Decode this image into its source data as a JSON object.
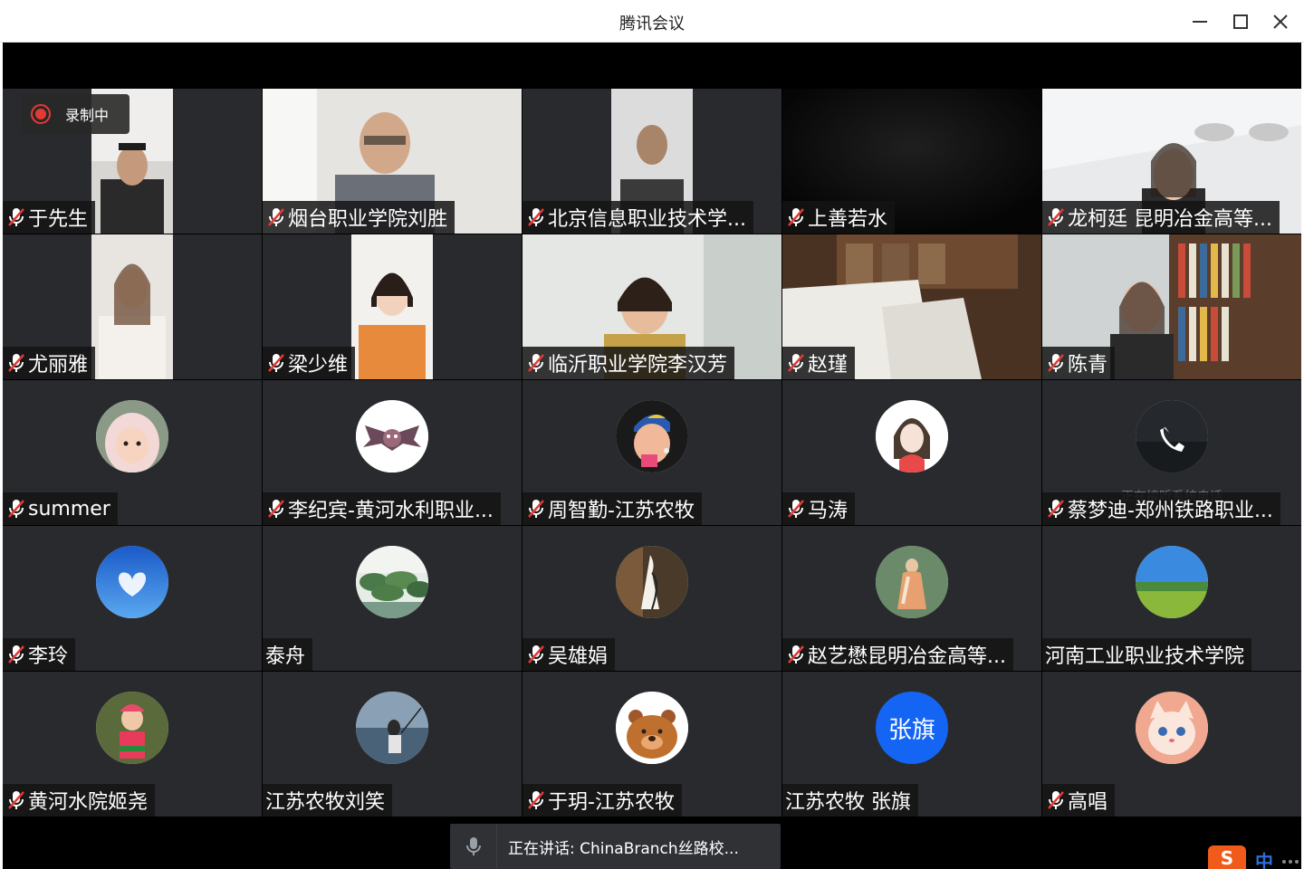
{
  "window": {
    "title": "腾讯会议",
    "controls": [
      "minimize-icon",
      "maximize-icon",
      "close-icon"
    ]
  },
  "recording": {
    "label": "录制中",
    "color": "#e53935"
  },
  "participants": [
    {
      "name": "于先生",
      "muted": true,
      "media": "video"
    },
    {
      "name": "烟台职业学院刘胜",
      "muted": true,
      "media": "video"
    },
    {
      "name": "北京信息职业技术学...",
      "muted": true,
      "media": "video"
    },
    {
      "name": "上善若水",
      "muted": true,
      "media": "video"
    },
    {
      "name": "龙柯廷 昆明冶金高等...",
      "muted": true,
      "media": "video"
    },
    {
      "name": "尤丽雅",
      "muted": true,
      "media": "video"
    },
    {
      "name": "梁少维",
      "muted": true,
      "media": "video"
    },
    {
      "name": "临沂职业学院李汉芳",
      "muted": true,
      "media": "video"
    },
    {
      "name": "赵瑾",
      "muted": true,
      "media": "video"
    },
    {
      "name": "陈青",
      "muted": true,
      "media": "video"
    },
    {
      "name": "summer",
      "muted": true,
      "media": "avatar",
      "avatar_icon": "child-photo-avatar"
    },
    {
      "name": "李纪宾-黄河水利职业...",
      "muted": true,
      "media": "avatar",
      "avatar_icon": "bat-cartoon-avatar"
    },
    {
      "name": "周智勤-江苏农牧",
      "muted": true,
      "media": "avatar",
      "avatar_icon": "pearl-earring-cartoon-avatar"
    },
    {
      "name": "马涛",
      "muted": true,
      "media": "avatar",
      "avatar_icon": "girl-illustration-avatar"
    },
    {
      "name": "蔡梦迪-郑州铁路职业...",
      "muted": true,
      "media": "avatar",
      "avatar_icon": "phone-call-avatar",
      "status": "正在接听系统电话"
    },
    {
      "name": "李玲",
      "muted": true,
      "media": "avatar",
      "avatar_icon": "sky-heart-cloud-avatar"
    },
    {
      "name": "泰舟",
      "muted": false,
      "media": "avatar",
      "avatar_icon": "lotus-pond-avatar"
    },
    {
      "name": "吴雄娟",
      "muted": true,
      "media": "avatar",
      "avatar_icon": "ink-painting-avatar"
    },
    {
      "name": "赵艺懋昆明冶金高等...",
      "muted": true,
      "media": "avatar",
      "avatar_icon": "classical-painting-avatar"
    },
    {
      "name": "河南工业职业技术学院",
      "muted": false,
      "media": "avatar",
      "avatar_icon": "grassland-avatar"
    },
    {
      "name": "黄河水院姬尧",
      "muted": true,
      "media": "avatar",
      "avatar_icon": "girl-photo-avatar"
    },
    {
      "name": "江苏农牧刘笑",
      "muted": false,
      "media": "avatar",
      "avatar_icon": "seaside-fishing-avatar"
    },
    {
      "name": "于玥-江苏农牧",
      "muted": true,
      "media": "avatar",
      "avatar_icon": "bear-cartoon-avatar"
    },
    {
      "name": "江苏农牧 张旗",
      "muted": false,
      "media": "avatar",
      "avatar_text": "张旗",
      "avatar_color": "#1565f5"
    },
    {
      "name": "高唱",
      "muted": true,
      "media": "avatar",
      "avatar_icon": "cat-cartoon-avatar"
    }
  ],
  "speaking": {
    "text": "正在讲话: ChinaBranch丝路校..."
  },
  "ime": {
    "logo": "S",
    "mode": "中"
  }
}
